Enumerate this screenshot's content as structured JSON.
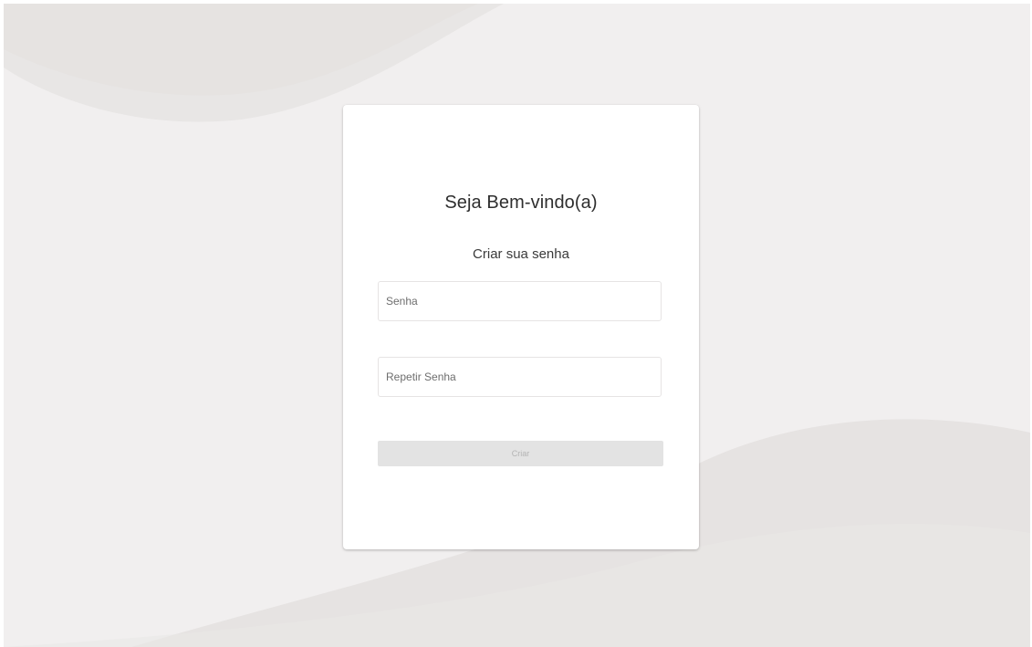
{
  "page": {
    "background_color": "#f1efef",
    "card_color": "#ffffff"
  },
  "card": {
    "title": "Seja Bem-vindo(a)",
    "subtitle": "Criar sua senha"
  },
  "form": {
    "password": {
      "value": "",
      "placeholder": "Senha"
    },
    "repeat_password": {
      "value": "",
      "placeholder": "Repetir Senha"
    },
    "submit": {
      "label": "Criar",
      "disabled": true
    }
  }
}
